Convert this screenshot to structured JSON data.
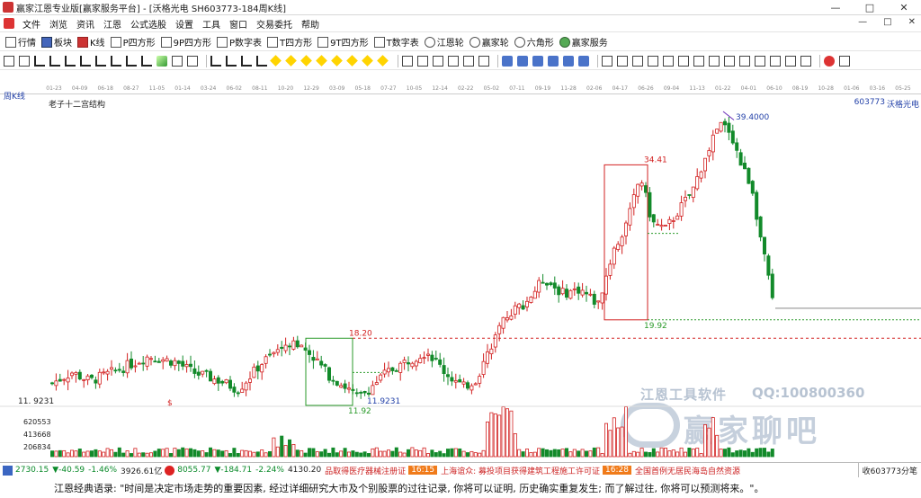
{
  "window": {
    "title": "赢家江恩专业版[赢家服务平台] - [沃格光电  SH603773-184周K线]",
    "controls": [
      "—",
      "□",
      "✕"
    ]
  },
  "menu": {
    "items": [
      "文件",
      "浏览",
      "资讯",
      "江恩",
      "公式选股",
      "设置",
      "工具",
      "窗口",
      "交易委托",
      "帮助"
    ],
    "right_controls": [
      "—",
      "□",
      "✕"
    ]
  },
  "toolbar1": {
    "items": [
      "行情",
      "板块",
      "K线",
      "P四方形",
      "9P四方形",
      "P数字表",
      "T四方形",
      "9T四方形",
      "T数字表",
      "江恩轮",
      "赢家轮",
      "六角形",
      "赢家服务"
    ]
  },
  "chart": {
    "period_label": "周K线",
    "title": "老子十二宫结构",
    "stock_code": "603773",
    "stock_name": "沃格光电",
    "date_ticks": [
      "01-23",
      "04-09",
      "06-18",
      "08-27",
      "11-05",
      "01-14",
      "03-24",
      "06-02",
      "08-11",
      "10-20",
      "12-29",
      "03-09",
      "05-18",
      "07-27",
      "10-05",
      "12-14",
      "02-22",
      "05-02",
      "07-11",
      "09-19",
      "11-28",
      "02-06",
      "04-17",
      "06-26",
      "09-04",
      "11-13",
      "01-22",
      "04-01",
      "06-10",
      "08-19",
      "10-28",
      "01-06",
      "03-16",
      "05-25"
    ],
    "annotations": {
      "high": "39.4000",
      "box2_top": "34.41",
      "box2_bottom": "19.92",
      "box1_top": "18.20",
      "box1_bottom": "11.92",
      "low_label": "11.9231",
      "left_price": "11. 9231",
      "dollar_mark": "$"
    },
    "volume_labels": [
      "620553",
      "413668",
      "206834"
    ],
    "watermark": {
      "software": "江恩工具软件",
      "qq": "QQ:100800360",
      "forum": "赢家聊吧"
    }
  },
  "chart_data": {
    "type": "candlestick",
    "title": "老子十二宫结构",
    "xlabel": "",
    "ylabel": "",
    "ylim": [
      11.92,
      39.4
    ],
    "marked_levels": [
      39.4,
      34.41,
      19.92,
      18.2,
      11.92
    ],
    "volume_axis_ticks": [
      620553,
      413668,
      206834
    ]
  },
  "ticker": {
    "sh_index": "2730.15",
    "sh_change": "▼-40.59",
    "sh_pct": "-1.46%",
    "sh_amount": "3926.61亿",
    "sz_index": "8055.77",
    "sz_change": "▼-184.71",
    "sz_pct": "-2.24%",
    "sz_amount": "4130.20",
    "news1": "品取得医疗器械注册证",
    "time1": "16:15",
    "news2": "上海谊众: 募投项目获得建筑工程施工许可证",
    "time2": "16:28",
    "news3": "全国首例无居民海岛自然资源",
    "stock_box": "收603773分笔"
  },
  "quote": {
    "text": "江恩经典语录: \"时间是决定市场走势的重要因素, 经过详细研究大市及个别股票的过往记录, 你将可以证明, 历史确实重复发生; 而了解过往, 你将可以预测将来。\"。"
  },
  "colors": {
    "up": "#d22020",
    "down": "#128a2a",
    "box": "#d22020",
    "box1": "#2a9a2a",
    "text_blue": "#2341a8"
  }
}
